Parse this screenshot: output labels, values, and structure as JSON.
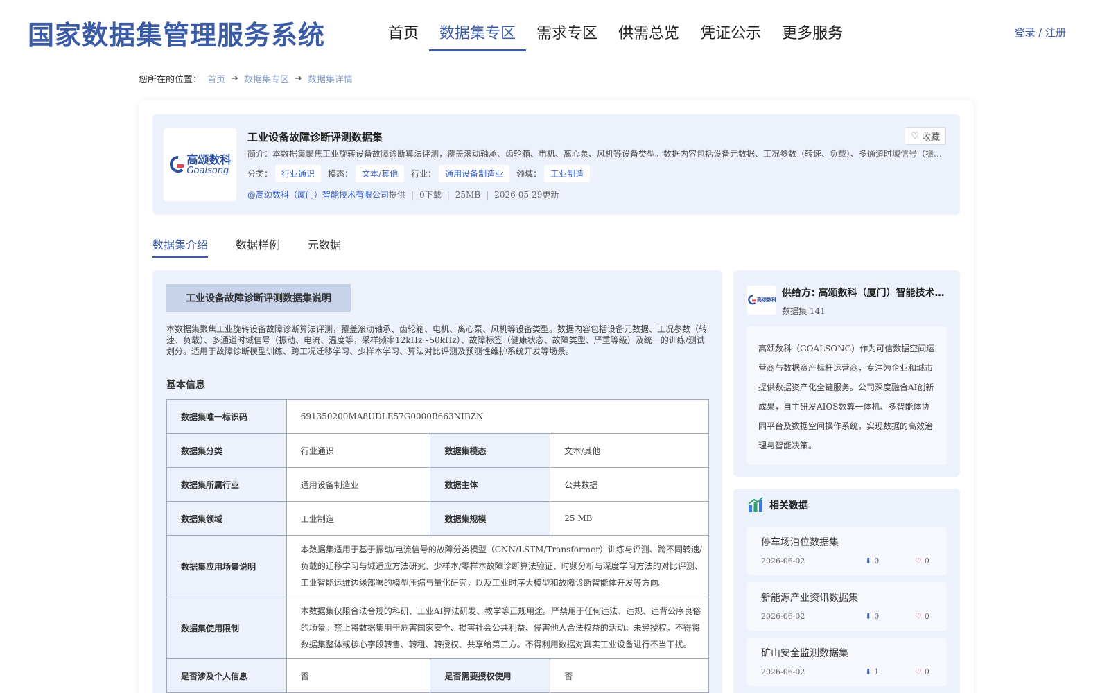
{
  "header": {
    "site_title": "国家数据集管理服务系统",
    "nav": [
      {
        "label": "首页",
        "active": false
      },
      {
        "label": "数据集专区",
        "active": true
      },
      {
        "label": "需求专区",
        "active": false
      },
      {
        "label": "供需总览",
        "active": false
      },
      {
        "label": "凭证公示",
        "active": false
      },
      {
        "label": "更多服务",
        "active": false
      }
    ],
    "login": "登录 / 注册"
  },
  "breadcrumb": {
    "lead": "您所在的位置：",
    "items": [
      "首页",
      "数据集专区",
      "数据集详情"
    ]
  },
  "dataset": {
    "logo_cn": "高颂数科",
    "logo_en": "Goalsong",
    "title": "工业设备故障诊断评测数据集",
    "favorite": "收藏",
    "intro": "简介：本数据集聚焦工业旋转设备故障诊断算法评测，覆盖滚动轴承、齿轮箱、电机、离心泵、风机等设备类型。数据内容包括设备元数据、工况参数（转速、负载）、多通道时域信号（振动、电流、温度等，采样频率12kHz~50kHz）、故障标签（健康状态、故障类型、严重等级）及统一的训练/测试划分。",
    "tags": {
      "category_label": "分类：",
      "category": "行业通识",
      "modality_label": "模态：",
      "modality": "文本/其他",
      "industry_label": "行业：",
      "industry": "通用设备制造业",
      "domain_label": "领域：",
      "domain": "工业制造"
    },
    "meta": {
      "provider": "@高颂数科（厦门）智能技术有限公司",
      "provided": "提供",
      "downloads": "0下载",
      "size": "25MB",
      "updated": "2026-05-29更新"
    }
  },
  "tabs": [
    "数据集介绍",
    "数据样例",
    "元数据"
  ],
  "content": {
    "section_title": "工业设备故障诊断评测数据集说明",
    "description": "本数据集聚焦工业旋转设备故障诊断算法评测，覆盖滚动轴承、齿轮箱、电机、离心泵、风机等设备类型。数据内容包括设备元数据、工况参数（转速、负载）、多通道时域信号（振动、电流、温度等，采样频率12kHz~50kHz）、故障标签（健康状态、故障类型、严重等级）及统一的训练/测试划分。适用于故障诊断模型训练、跨工况迁移学习、少样本学习、算法对比评测及预测性维护系统开发等场景。",
    "basic_info_title": "基本信息",
    "table": {
      "id_key": "数据集唯一标识码",
      "id_val": "691350200MA8UDLE57G0000B663NIBZN",
      "cat_key": "数据集分类",
      "cat_val": "行业通识",
      "mod_key": "数据集模态",
      "mod_val": "文本/其他",
      "ind_key": "数据集所属行业",
      "ind_val": "通用设备制造业",
      "subj_key": "数据主体",
      "subj_val": "公共数据",
      "dom_key": "数据集领域",
      "dom_val": "工业制造",
      "scale_key": "数据集规模",
      "scale_val": "25 MB",
      "scene_key": "数据集应用场景说明",
      "scene_val": "本数据集适用于基于振动/电流信号的故障分类模型（CNN/LSTM/Transformer）训练与评测、跨不同转速/负载的迁移学习与域适应方法研究、少样本/零样本故障诊断算法验证、时频分析与深度学习方法的对比评测、工业智能运维边缘部署的模型压缩与量化研究，以及工业时序大模型和故障诊断智能体开发等方向。",
      "limit_key": "数据集使用限制",
      "limit_val": "本数据集仅限合法合规的科研、工业AI算法研发、教学等正规用途。严禁用于任何违法、违规、违背公序良俗的场景。禁止将数据集用于危害国家安全、损害社会公共利益、侵害他人合法权益的活动。未经授权，不得将数据集整体或核心字段转售、转租、转授权、共享给第三方。不得利用数据对真实工业设备进行不当干扰。",
      "personal_key": "是否涉及个人信息",
      "personal_val": "否",
      "auth_key": "是否需要授权使用",
      "auth_val": "否"
    }
  },
  "provider_card": {
    "name": "供给方: 高颂数科（厦门）智能技术有限公司",
    "count": "数据集 141",
    "desc": "高颂数科（GOALSONG）作为可信数据空间运营商与数据资产标杆运营商，专注为企业和城市提供数据资产化全链服务。公司深度融合AI创新成果，自主研发AIOS数算一体机、多智能体协同平台及数据空间操作系统，实现数据的高效治理与智能决策。"
  },
  "related": {
    "title": "相关数据",
    "items": [
      {
        "name": "停车场泊位数据集",
        "date": "2026-06-02",
        "downloads": "0",
        "likes": "0"
      },
      {
        "name": "新能源产业资讯数据集",
        "date": "2026-06-02",
        "downloads": "0",
        "likes": "0"
      },
      {
        "name": "矿山安全监测数据集",
        "date": "2026-06-02",
        "downloads": "1",
        "likes": "0"
      }
    ]
  },
  "colors": {
    "brand": "#3b5ba5",
    "panel_bg": "#ecf1fb",
    "tag_text": "#3b63c4"
  }
}
